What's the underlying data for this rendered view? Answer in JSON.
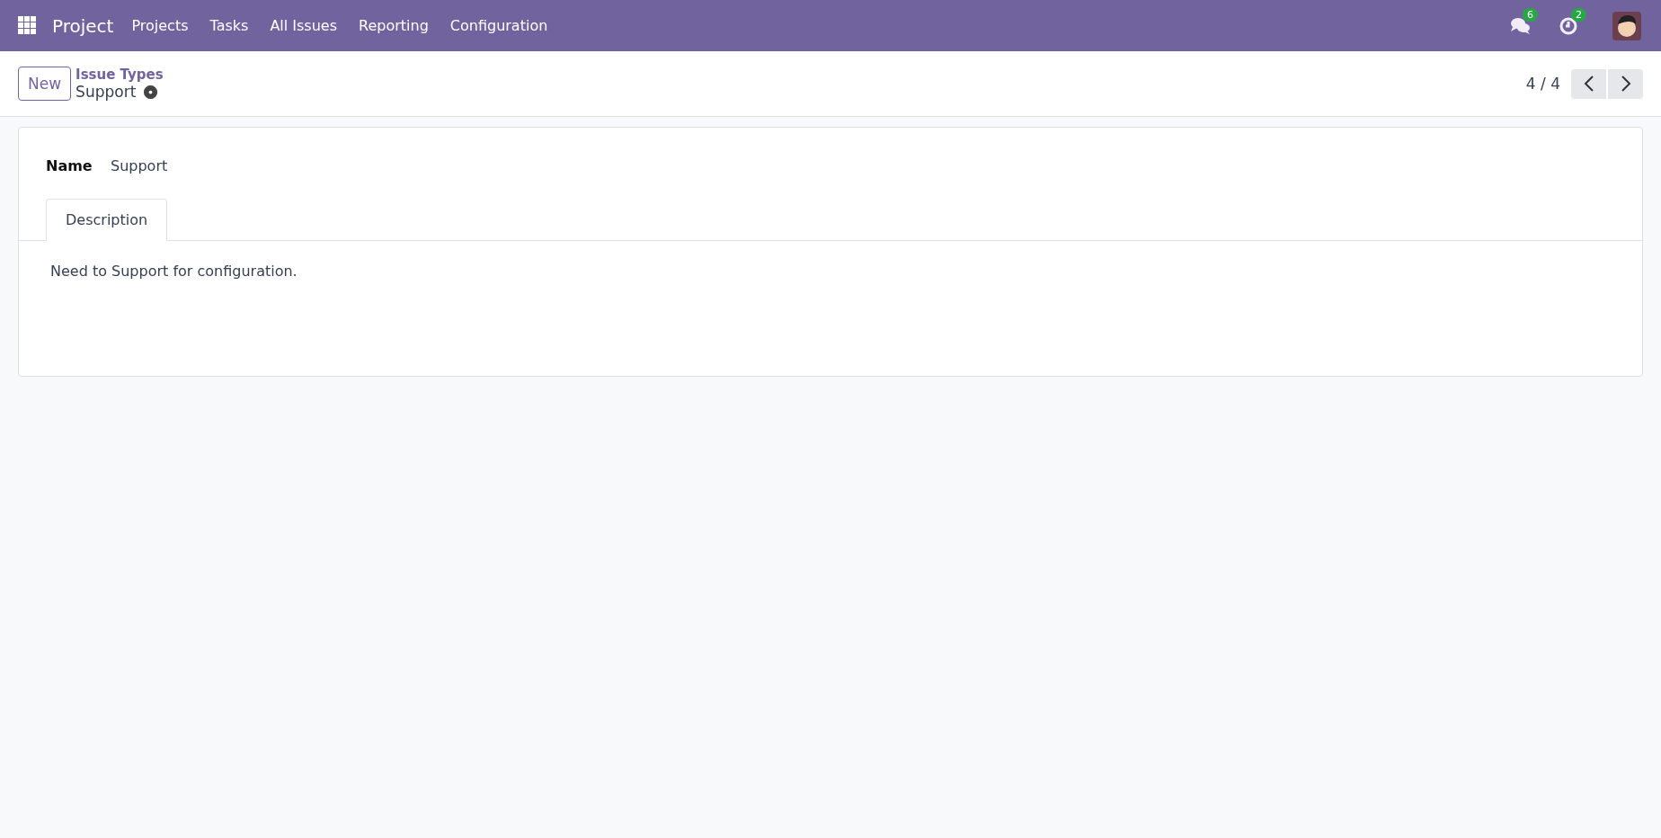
{
  "navbar": {
    "app_name": "Project",
    "menu": [
      "Projects",
      "Tasks",
      "All Issues",
      "Reporting",
      "Configuration"
    ],
    "messages_count": "6",
    "activities_count": "2"
  },
  "control_panel": {
    "new_button": "New",
    "breadcrumb": "Issue Types",
    "record_title": "Support",
    "pager": "4 / 4"
  },
  "form": {
    "name_label": "Name",
    "name_value": "Support",
    "tabs": [
      {
        "label": "Description",
        "selected": true
      }
    ],
    "description": "Need to Support for configuration."
  }
}
